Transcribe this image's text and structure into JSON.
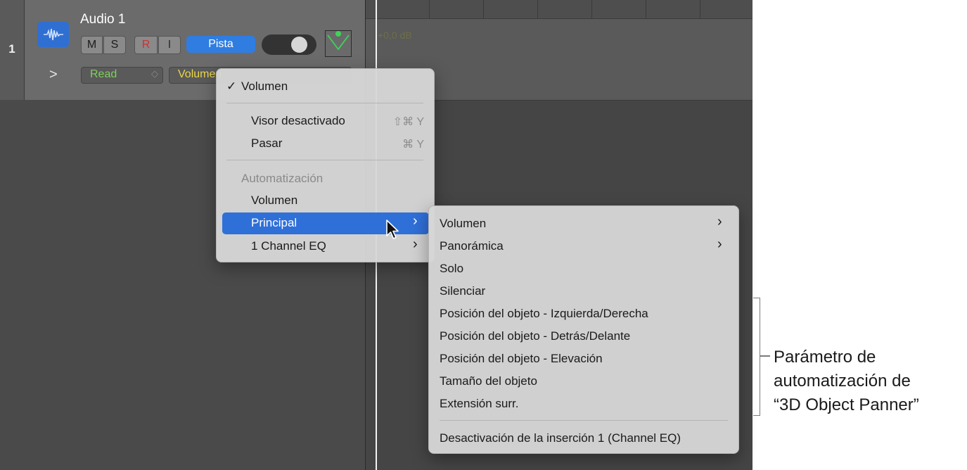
{
  "track": {
    "number": "1",
    "name": "Audio 1",
    "buttons": {
      "mute": "M",
      "solo": "S",
      "record": "R",
      "input": "I",
      "track_button": "Pista"
    },
    "automation_mode": "Read",
    "automation_param": "Volumen",
    "lane_value": "+0,0 dB"
  },
  "menu1": {
    "checked": "✓",
    "checked_item": "Volumen",
    "item_visor": "Visor desactivado",
    "item_visor_shortcut": "⇧⌘ Y",
    "item_pasar": "Pasar",
    "item_pasar_shortcut": "⌘ Y",
    "section_label": "Automatización",
    "item_volumen": "Volumen",
    "item_principal": "Principal",
    "item_channel_eq": "1 Channel EQ",
    "submenu_arrow": "›"
  },
  "menu2": {
    "items": [
      "Volumen",
      "Panorámica",
      "Solo",
      "Silenciar",
      "Posición del objeto - Izquierda/Derecha",
      "Posición del objeto - Detrás/Delante",
      "Posición del objeto - Elevación",
      "Tamaño del objeto",
      "Extensión surr."
    ],
    "footer_item": "Desactivación de la inserción 1 (Channel EQ)",
    "submenu_arrow": "›"
  },
  "callout": {
    "line1": "Parámetro de",
    "line2": "automatización de",
    "line3": "“3D Object Panner”"
  },
  "colors": {
    "accent_blue": "#2f7de1",
    "highlight": "#2f6fd8",
    "read_green": "#7fd05c",
    "param_yellow": "#ecd64a",
    "record_red": "#d03030"
  }
}
